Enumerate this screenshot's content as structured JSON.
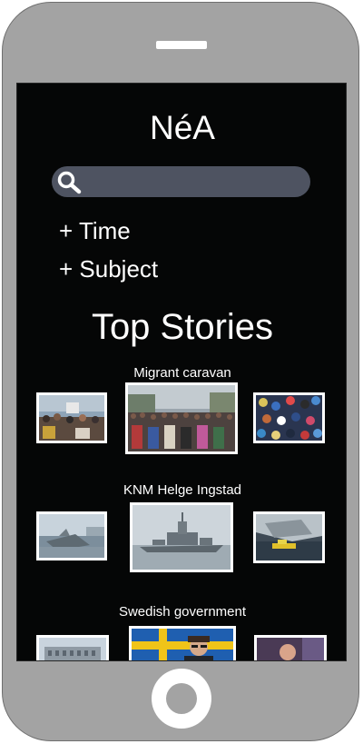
{
  "app": {
    "title": "NéA"
  },
  "search": {
    "placeholder": "",
    "value": ""
  },
  "filters": {
    "time_label": "+ Time",
    "subject_label": "+ Subject"
  },
  "section": {
    "title": "Top Stories"
  },
  "stories": [
    {
      "title": "Migrant caravan",
      "images": [
        "crowd-with-banner-photo",
        "marching-crowd-photo",
        "crowd-aerial-photo"
      ]
    },
    {
      "title": "KNM Helge Ingstad",
      "images": [
        "sinking-ship-photo",
        "frigate-photo",
        "wreck-rescue-boat-photo"
      ]
    },
    {
      "title": "Swedish government",
      "images": [
        "parliament-building-photo",
        "politician-flag-photo",
        "politician-portrait-photo"
      ]
    }
  ],
  "colors": {
    "screen_bg": "#050606",
    "phone_body": "#a3a3a3",
    "search_bar": "#4e5361",
    "text": "#ffffff"
  },
  "icons": [
    "search-icon"
  ]
}
